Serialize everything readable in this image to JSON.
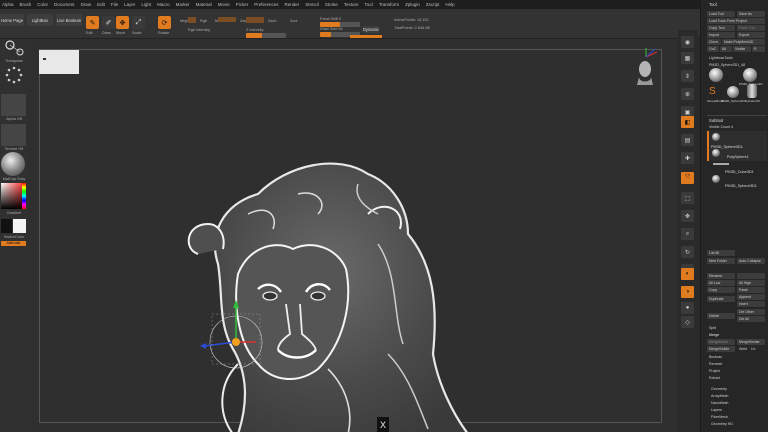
{
  "menubar": {
    "items": [
      "Alpha",
      "Brush",
      "Color",
      "Document",
      "Draw",
      "Edit",
      "File",
      "Layer",
      "Light",
      "Macro",
      "Marker",
      "Material",
      "Movie",
      "Picker",
      "Preferences",
      "Render",
      "Stencil",
      "Stroke",
      "Texture",
      "Tool",
      "Transform",
      "Zplugin",
      "Zscript",
      "Help"
    ]
  },
  "toolbar": {
    "home_page": "Home Page",
    "lightbox": "LightBox",
    "live_boolean": "Live Boolean",
    "edit": "Edit",
    "draw": "Draw",
    "move": "Move",
    "scale": "Scale",
    "rotate": "Rotate",
    "mrgb": "Mrgb",
    "rgb": "Rgb",
    "m": "M",
    "zadd": "Zadd",
    "zsub": "Zsub",
    "zcut": "Zcut",
    "rgb_intensity": "Rgb Intensity",
    "z_intensity": "Z Intensity",
    "focal_shift": "Focal Shift 0",
    "focal_shift_value": 0,
    "draw_size": "Draw Size 64",
    "draw_size_value": 64,
    "dynamic": "Dynamic",
    "active_points": "ActivePoints: 19,152",
    "total_points": "TotalPoints: 2.846 Mil"
  },
  "left_shelf": {
    "transpose_label": "Transpose",
    "alpha_label": "Alpha Off",
    "texture_label": "Texture Off",
    "material_label": "MatCap Gray",
    "gradient_label": "Gradient",
    "switch_color_label": "SwitchColor",
    "alternate_label": "Alternate"
  },
  "tool_palette": {
    "title": "Tool",
    "buttons": [
      [
        "Load Tool",
        "Save As"
      ],
      [
        "Load Tools From Project",
        ""
      ],
      [
        "Copy Tool",
        "Paste Tool"
      ],
      [
        "Import",
        "Export"
      ],
      [
        "Clone",
        "Make PolyMesh3D"
      ],
      [
        "GoZ",
        "All",
        "Visible",
        "R"
      ]
    ],
    "lightbox_tools": "Lightbox▸Tools",
    "current_tool": "PM3D_Sphere3D1_48",
    "tool_thumbs": [
      "PM3D_Sphere3D",
      "SimpleBrush",
      "PM3D_Sphere3D1",
      "Cylinder3D"
    ],
    "subtool_header": "Subtool",
    "visible_count": "Visible Count 4",
    "subtools": [
      "PM3D_Sphere3D1",
      "PolySphere1",
      "PM3D_Cube3D1",
      "PM3D_Sphere3D1"
    ],
    "list_all": "List All",
    "new_folder": "New Folder",
    "auto_collapse": "Auto Collapse",
    "rename": "Rename",
    "all_low": "All Low",
    "all_high": "All High",
    "copy": "Copy",
    "paste": "Paste",
    "duplicate": "Duplicate",
    "append": "Append",
    "insert": "Insert",
    "delete": "Delete",
    "del_other": "Del Other",
    "del_all": "Del All",
    "split": "Split",
    "merge": "Merge",
    "merge_down": "MergeDown",
    "merge_similar": "MergeSimilar",
    "merge_visible": "MergeVisible",
    "weld": "Weld",
    "uv": "Uv",
    "boolean": "Boolean",
    "remesh": "Remesh",
    "project": "Project",
    "extract": "Extract",
    "geometry": "Geometry",
    "array_mesh": "ArrayMesh",
    "nano_mesh": "NanoMesh",
    "layers": "Layers",
    "fiber_mesh": "FiberMesh",
    "geometry_hd": "Geometry HD"
  },
  "bottom": {
    "close_label": "X"
  },
  "colors": {
    "accent": "#e07b20",
    "bg": "#2b2b2b",
    "panel": "#262626"
  }
}
